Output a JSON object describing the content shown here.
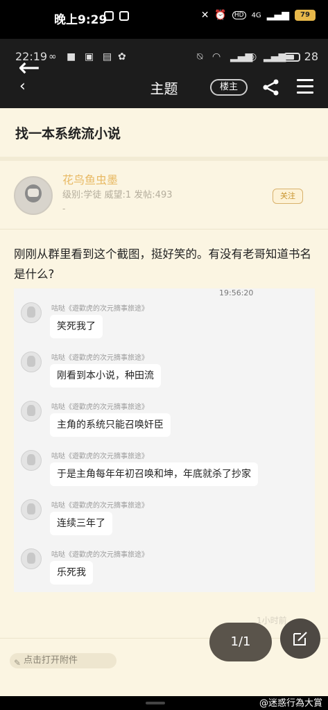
{
  "outer_status": {
    "time": "晚上9:29",
    "network": "4G",
    "hd": "HD",
    "battery": "79"
  },
  "inner_status": {
    "time": "22:19",
    "battery_pct": "28"
  },
  "nav": {
    "title": "主题",
    "louzhu_label": "楼主"
  },
  "post": {
    "title": "找一本系统流小说",
    "author": "花鸟鱼虫墨",
    "meta": "级别:学徒 威望:1 发帖:493",
    "meta_extra": "-",
    "follow_label": "关注",
    "body": "刚刚从群里看到这个截图，挺好笑的。有没有老哥知道书名是什么?"
  },
  "chat": {
    "timestamp": "19:56:20",
    "messages": [
      {
        "name": "咕哒《遊歡虎的次元摘事旅途》",
        "text": "笑死我了"
      },
      {
        "name": "咕哒《遊歡虎的次元摘事旅途》",
        "text": "刚看到本小说，种田流"
      },
      {
        "name": "咕哒《遊歡虎的次元摘事旅途》",
        "text": "主角的系统只能召唤奸臣"
      },
      {
        "name": "咕哒《遊歡虎的次元摘事旅途》",
        "text": "于是主角每年年初召唤和坤，年底就杀了抄家"
      },
      {
        "name": "咕哒《遊歡虎的次元摘事旅途》",
        "text": "连续三年了"
      },
      {
        "name": "咕哒《遊歡虎的次元摘事旅途》",
        "text": "乐死我"
      }
    ]
  },
  "footer": {
    "faint_time": "1小时前",
    "attachment_label": "点击打开附件",
    "page_indicator": "1/1"
  },
  "watermark": "@迷惑行為大賞"
}
